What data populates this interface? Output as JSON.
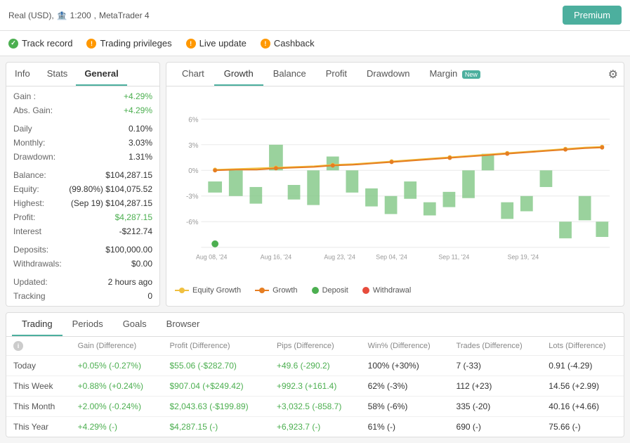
{
  "header": {
    "account_info": "Real (USD),",
    "leverage": "1:200",
    "platform": "MetaTrader 4",
    "premium_label": "Premium"
  },
  "nav": {
    "track_record": "Track record",
    "trading_privileges": "Trading privileges",
    "live_update": "Live update",
    "cashback": "Cashback"
  },
  "left_panel": {
    "tabs": [
      "Info",
      "Stats",
      "General"
    ],
    "active_tab": "General",
    "info_rows": [
      {
        "label": "Gain :",
        "value": "+4.29%",
        "color": "green"
      },
      {
        "label": "Abs. Gain:",
        "value": "+4.29%",
        "color": "green"
      },
      {
        "label": "",
        "value": ""
      },
      {
        "label": "Daily",
        "value": "0.10%",
        "color": "normal"
      },
      {
        "label": "Monthly:",
        "value": "3.03%",
        "color": "normal"
      },
      {
        "label": "Drawdown:",
        "value": "1.31%",
        "color": "normal"
      },
      {
        "label": "",
        "value": ""
      },
      {
        "label": "Balance:",
        "value": "$104,287.15",
        "color": "normal"
      },
      {
        "label": "Equity:",
        "value": "(99.80%) $104,075.52",
        "color": "normal"
      },
      {
        "label": "Highest:",
        "value": "(Sep 19) $104,287.15",
        "color": "normal"
      },
      {
        "label": "Profit:",
        "value": "$4,287.15",
        "color": "green"
      },
      {
        "label": "Interest",
        "value": "-$212.74",
        "color": "normal"
      },
      {
        "label": "",
        "value": ""
      },
      {
        "label": "Deposits:",
        "value": "$100,000.00",
        "color": "normal"
      },
      {
        "label": "Withdrawals:",
        "value": "$0.00",
        "color": "normal"
      },
      {
        "label": "",
        "value": ""
      },
      {
        "label": "Updated:",
        "value": "2 hours ago",
        "color": "normal"
      },
      {
        "label": "Tracking",
        "value": "0",
        "color": "normal"
      }
    ]
  },
  "chart_tabs": [
    "Chart",
    "Growth",
    "Balance",
    "Profit",
    "Drawdown",
    "Margin"
  ],
  "chart": {
    "active_tab": "Growth",
    "new_badge": "New",
    "y_labels": [
      "6%",
      "3%",
      "0%",
      "-3%",
      "-6%"
    ],
    "x_labels": [
      "Aug 08, '24",
      "Aug 16, '24",
      "Aug 23, '24",
      "Sep 04, '24",
      "Sep 11, '24",
      "Sep 19, '24"
    ],
    "legend": [
      {
        "type": "line",
        "color": "#f0c040",
        "label": "Equity Growth"
      },
      {
        "type": "line",
        "color": "#e67e22",
        "label": "Growth"
      },
      {
        "type": "dot",
        "color": "#4caf50",
        "label": "Deposit"
      },
      {
        "type": "dot",
        "color": "#e74c3c",
        "label": "Withdrawal"
      }
    ]
  },
  "bottom_tabs": [
    "Trading",
    "Periods",
    "Goals",
    "Browser"
  ],
  "table": {
    "headers": [
      "",
      "Gain (Difference)",
      "Profit (Difference)",
      "Pips (Difference)",
      "Win% (Difference)",
      "Trades (Difference)",
      "Lots (Difference)"
    ],
    "rows": [
      {
        "label": "Today",
        "gain": "+0.05% (-0.27%)",
        "profit": "$55.06 (-$282.70)",
        "pips": "+49.6 (-290.2)",
        "win": "100% (+30%)",
        "trades": "7 (-33)",
        "lots": "0.91 (-4.29)",
        "gain_color": "green",
        "profit_color": "green",
        "pips_color": "green"
      },
      {
        "label": "This Week",
        "gain": "+0.88% (+0.24%)",
        "profit": "$907.04 (+$249.42)",
        "pips": "+992.3 (+161.4)",
        "win": "62% (-3%)",
        "trades": "112 (+23)",
        "lots": "14.56 (+2.99)",
        "gain_color": "green",
        "profit_color": "green",
        "pips_color": "green"
      },
      {
        "label": "This Month",
        "gain": "+2.00% (-0.24%)",
        "profit": "$2,043.63 (-$199.89)",
        "pips": "+3,032.5 (-858.7)",
        "win": "58% (-6%)",
        "trades": "335 (-20)",
        "lots": "40.16 (+4.66)",
        "gain_color": "green",
        "profit_color": "green",
        "pips_color": "green"
      },
      {
        "label": "This Year",
        "gain": "+4.29% (-)",
        "profit": "$4,287.15 (-)",
        "pips": "+6,923.7 (-)",
        "win": "61% (-)",
        "trades": "690 (-)",
        "lots": "75.66 (-)",
        "gain_color": "green",
        "profit_color": "green",
        "pips_color": "green"
      }
    ]
  }
}
